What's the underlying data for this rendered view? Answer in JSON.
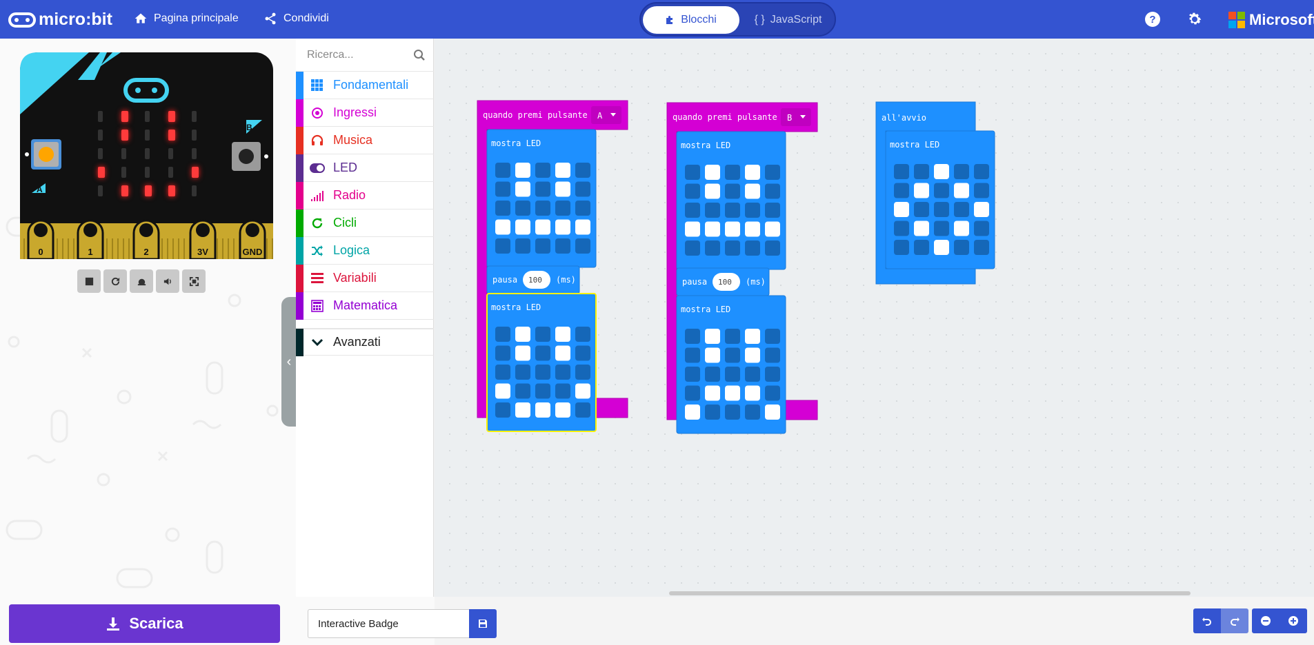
{
  "header": {
    "brand": "micro:bit",
    "nav_home": "Pagina principale",
    "nav_share": "Condividi",
    "mode_blocks": "Blocchi",
    "mode_js": "JavaScript",
    "ms_label": "Microsoft",
    "accent": "#3454d1"
  },
  "simulator": {
    "pins": [
      "0",
      "1",
      "2",
      "3V",
      "GND"
    ],
    "button_a": "A",
    "button_b": "B"
  },
  "toolbox": {
    "search_placeholder": "Ricerca...",
    "categories": [
      {
        "label": "Fondamentali",
        "color": "#1e90ff",
        "icon": "grid-icon"
      },
      {
        "label": "Ingressi",
        "color": "#d400d4",
        "icon": "target-icon"
      },
      {
        "label": "Musica",
        "color": "#e63022",
        "icon": "headphones-icon"
      },
      {
        "label": "LED",
        "color": "#5c2d91",
        "icon": "toggle-icon"
      },
      {
        "label": "Radio",
        "color": "#e3008c",
        "icon": "signal-icon"
      },
      {
        "label": "Cicli",
        "color": "#00aa00",
        "icon": "refresh-icon"
      },
      {
        "label": "Logica",
        "color": "#00a4a6",
        "icon": "shuffle-icon"
      },
      {
        "label": "Variabili",
        "color": "#dc143c",
        "icon": "list-icon"
      },
      {
        "label": "Matematica",
        "color": "#9400d3",
        "icon": "calculator-icon"
      },
      {
        "label": "Avanzati",
        "color": "#00272b",
        "icon": "chevron-down-icon"
      }
    ]
  },
  "workspace": {
    "on_button_label": "quando premi pulsante",
    "show_leds_label": "mostra LED",
    "pause_label": "pausa",
    "pause_unit": "(ms)",
    "on_start_label": "all'avvio",
    "block_a": {
      "button": "A",
      "pause": "100",
      "leds_1": [
        [
          0,
          1,
          0,
          1,
          0
        ],
        [
          0,
          1,
          0,
          1,
          0
        ],
        [
          0,
          0,
          0,
          0,
          0
        ],
        [
          1,
          1,
          1,
          1,
          1
        ],
        [
          0,
          0,
          0,
          0,
          0
        ]
      ],
      "leds_2": [
        [
          0,
          1,
          0,
          1,
          0
        ],
        [
          0,
          1,
          0,
          1,
          0
        ],
        [
          0,
          0,
          0,
          0,
          0
        ],
        [
          1,
          0,
          0,
          0,
          1
        ],
        [
          0,
          1,
          1,
          1,
          0
        ]
      ]
    },
    "block_b": {
      "button": "B",
      "pause": "100",
      "leds_1": [
        [
          0,
          1,
          0,
          1,
          0
        ],
        [
          0,
          1,
          0,
          1,
          0
        ],
        [
          0,
          0,
          0,
          0,
          0
        ],
        [
          1,
          1,
          1,
          1,
          1
        ],
        [
          0,
          0,
          0,
          0,
          0
        ]
      ],
      "leds_2": [
        [
          0,
          1,
          0,
          1,
          0
        ],
        [
          0,
          1,
          0,
          1,
          0
        ],
        [
          0,
          0,
          0,
          0,
          0
        ],
        [
          0,
          1,
          1,
          1,
          0
        ],
        [
          1,
          0,
          0,
          0,
          1
        ]
      ]
    },
    "block_start": {
      "leds": [
        [
          0,
          0,
          1,
          0,
          0
        ],
        [
          0,
          1,
          0,
          1,
          0
        ],
        [
          1,
          0,
          0,
          0,
          1
        ],
        [
          0,
          1,
          0,
          1,
          0
        ],
        [
          0,
          0,
          1,
          0,
          0
        ]
      ]
    }
  },
  "footer": {
    "download_label": "Scarica",
    "project_name": "Interactive Badge"
  }
}
